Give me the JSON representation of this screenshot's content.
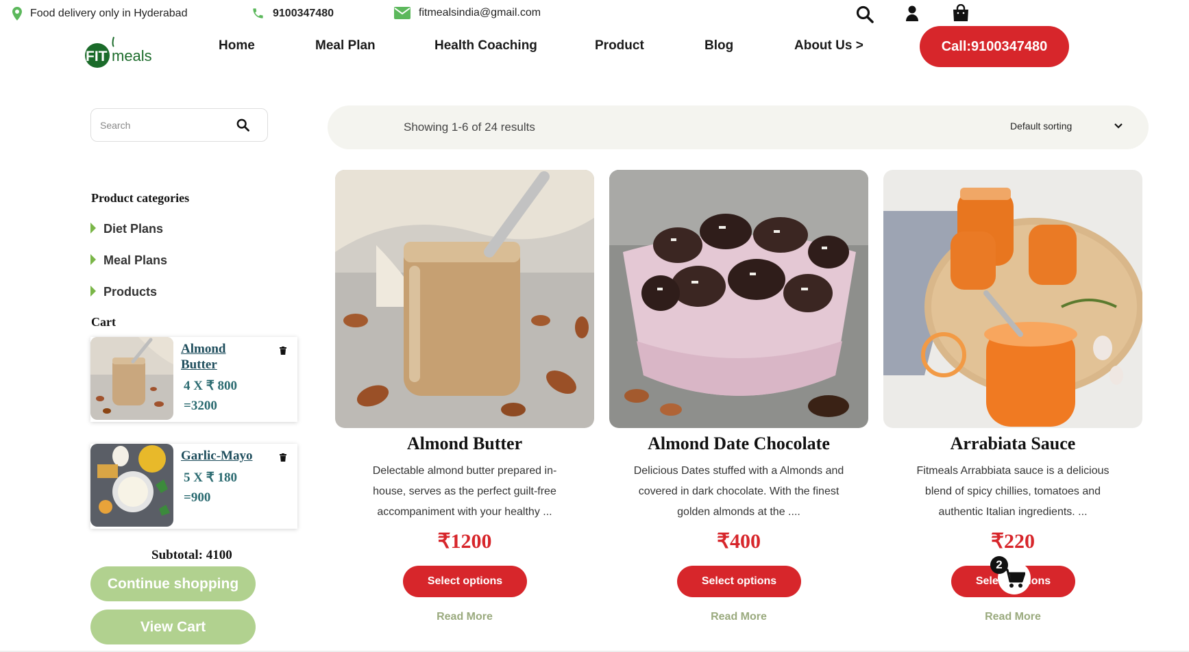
{
  "topbar": {
    "delivery_text": "Food delivery only in Hyderabad",
    "phone": "9100347480",
    "email": "fitmealsindia@gmail.com"
  },
  "brand": {
    "logo_fit": "FIT",
    "logo_meals": "meals",
    "green": "#1b6b2a"
  },
  "nav": {
    "items": [
      "Home",
      "Meal Plan",
      "Health Coaching",
      "Product",
      "Blog",
      "About Us >"
    ],
    "call_button": "Call:9100347480"
  },
  "colors": {
    "accent_red": "#d7262b",
    "soft_green": "#b1d18f",
    "category_arrow": "#7ab648"
  },
  "sidebar": {
    "search_placeholder": "Search",
    "categories_heading": "Product categories",
    "categories": [
      "Diet Plans",
      "Meal Plans",
      "Products"
    ],
    "cart_heading": "Cart",
    "cart_items": [
      {
        "name": "Almond Butter",
        "qty_line": "4 X ₹ 800",
        "total_line": "=3200"
      },
      {
        "name": "Garlic-Mayo",
        "qty_line": "5 X ₹ 180",
        "total_line": "=900"
      }
    ],
    "subtotal": "Subtotal: 4100",
    "continue_button": "Continue shopping",
    "view_cart_button": "View Cart"
  },
  "results": {
    "showing_text": "Showing 1-6 of 24 results",
    "sorting_value": "Default sorting"
  },
  "products": [
    {
      "title": "Almond Butter",
      "description": "Delectable almond butter prepared in-house, serves as the perfect guilt-free accompaniment with your healthy ...",
      "price": "₹1200",
      "button": "Select options",
      "read_more": "Read More"
    },
    {
      "title": "Almond Date Chocolate",
      "description": "Delicious Dates stuffed with a Almonds and covered in dark chocolate. With the finest golden almonds at the ....",
      "price": "₹400",
      "button": "Select options",
      "read_more": "Read More"
    },
    {
      "title": "Arrabiata Sauce",
      "description": "Fitmeals Arrabbiata sauce is a delicious blend of spicy chillies, tomatoes and authentic Italian ingredients. ...",
      "price": "₹220",
      "button": "Select options",
      "read_more": "Read More"
    }
  ],
  "floating_cart": {
    "count": "2"
  },
  "icons": [
    "map-pin-icon",
    "phone-icon",
    "envelope-icon",
    "search-icon",
    "user-icon",
    "shopping-bag-icon",
    "trash-icon",
    "chevron-down-icon",
    "cart-icon"
  ]
}
